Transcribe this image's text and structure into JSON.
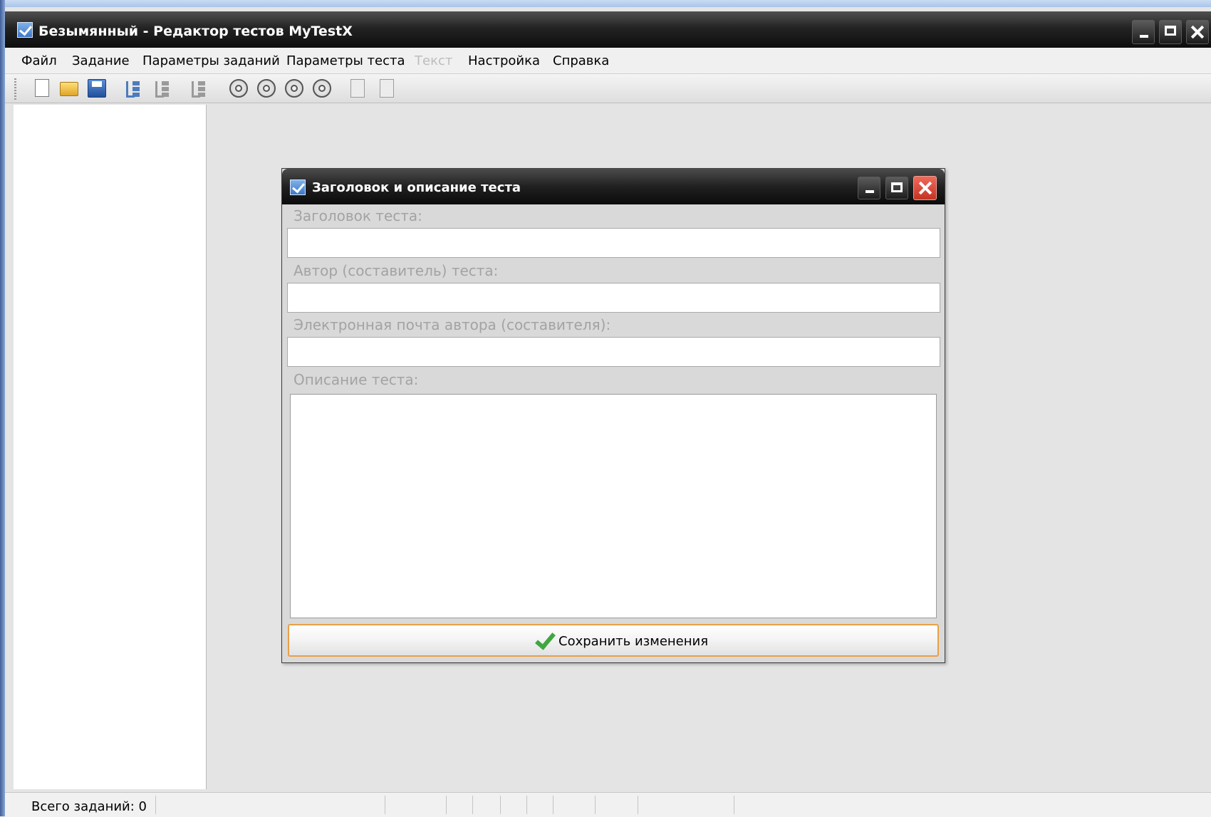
{
  "app": {
    "title": "Безымянный - Редактор тестов MyTestX"
  },
  "menu": {
    "items": [
      {
        "label": "Файл"
      },
      {
        "label": "Задание"
      },
      {
        "label": "Параметры заданий"
      },
      {
        "label": "Параметры теста"
      },
      {
        "label": "Текст"
      },
      {
        "label": "Настройка"
      },
      {
        "label": "Справка"
      }
    ]
  },
  "status": {
    "total_tasks": "Всего заданий: 0"
  },
  "dialog": {
    "title": "Заголовок и описание теста",
    "fields": [
      {
        "label": "Заголовок теста:",
        "value": ""
      },
      {
        "label": "Автор (составитель) теста:",
        "value": ""
      },
      {
        "label": "Электронная почта автора (составителя):",
        "value": ""
      }
    ],
    "description_label": "Описание теста:",
    "description_value": "",
    "save_label": "Сохранить изменения"
  },
  "colors": {
    "accent": "#e8a047",
    "close_button": "#d9453a",
    "save_check": "#3fa73f"
  }
}
